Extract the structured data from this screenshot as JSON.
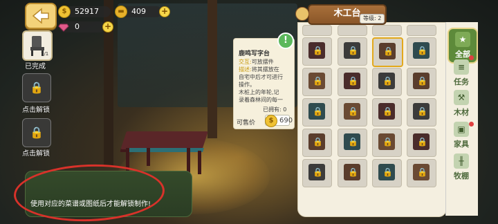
{
  "hud": {
    "coins": "52917",
    "gold": "409",
    "gems": "0"
  },
  "slots": [
    {
      "label": "已完成",
      "count": "1/1",
      "state": "done"
    },
    {
      "label": "点击解锁",
      "state": "locked"
    },
    {
      "label": "点击解锁",
      "state": "locked"
    }
  ],
  "hint": {
    "text": "使用对应的菜谱或图纸后才能解锁制作!"
  },
  "info_card": {
    "title": "鹿鸣写字台",
    "interact_key": "交互:",
    "interact_val": "可放摆件",
    "desc_key": "描述:",
    "desc_lines": [
      "将其摆放在",
      "自宅中后才可进行",
      "操作。"
    ],
    "flavor_lines": [
      "木桩上的年轮,记",
      "录着森林间的每一"
    ],
    "owned": "已拥有: 0",
    "price_label": "可售价",
    "price": "690"
  },
  "panel": {
    "title": "木工台",
    "level": "等级: 2"
  },
  "tabs": [
    {
      "label": "全部",
      "icon": "star-icon",
      "active": true
    },
    {
      "label": "任务",
      "icon": "scroll-icon",
      "active": false
    },
    {
      "label": "木材",
      "icon": "saw-icon",
      "active": false
    },
    {
      "label": "家具",
      "icon": "cabinet-icon",
      "active": false
    },
    {
      "label": "牧棚",
      "icon": "fence-icon",
      "active": false
    }
  ],
  "colors": {
    "accent_green": "#5d8a3a",
    "selection_gold": "#e2a81b",
    "annotation_red": "#d8322a"
  }
}
